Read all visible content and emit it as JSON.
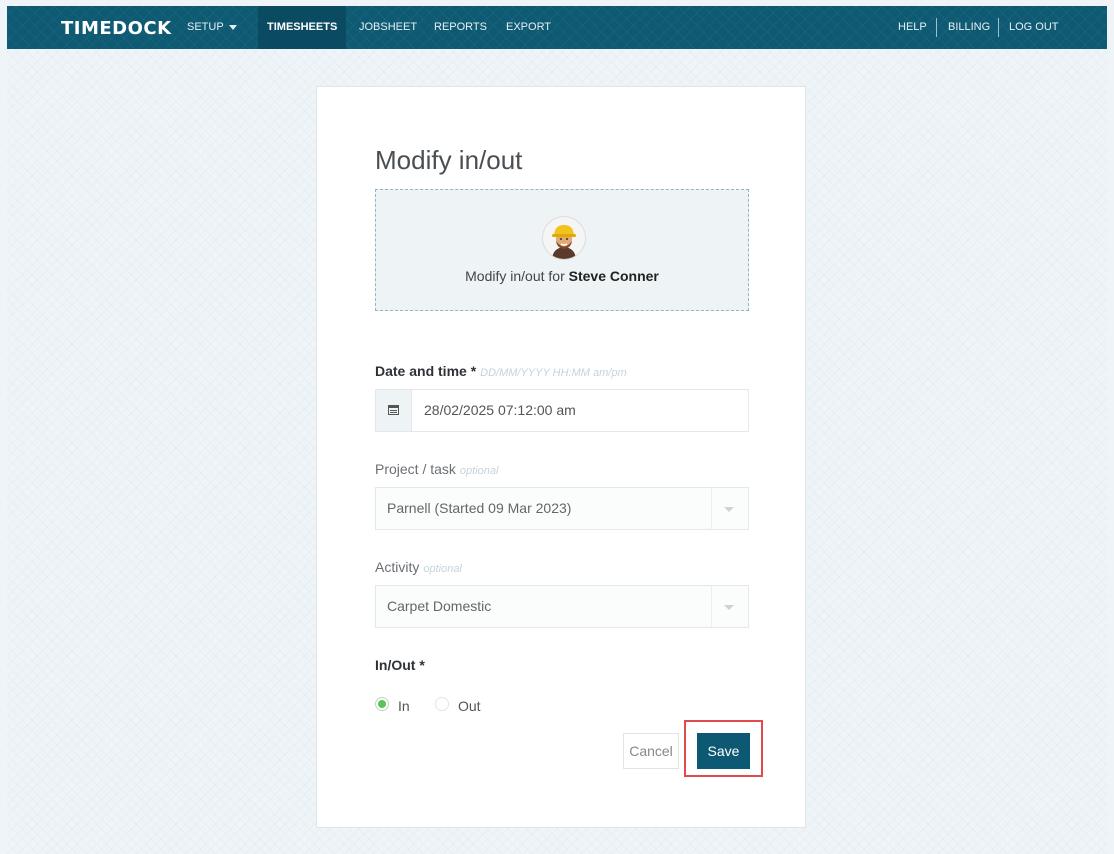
{
  "nav": {
    "logo": "TIMEDOCK",
    "items": [
      "SETUP",
      "TIMESHEETS",
      "JOBSHEET",
      "REPORTS",
      "EXPORT"
    ],
    "right": [
      "HELP",
      "BILLING",
      "LOG OUT"
    ]
  },
  "form": {
    "title": "Modify in/out",
    "employee_prefix": "Modify in/out for ",
    "employee_name": "Steve Conner",
    "date_label": "Date and time *",
    "date_hint": "DD/MM/YYYY HH:MM am/pm",
    "date_value": "28/02/2025 07:12:00 am",
    "project_label": "Project / task",
    "project_hint": "optional",
    "project_value": "Parnell (Started 09 Mar 2023)",
    "activity_label": "Activity",
    "activity_hint": "optional",
    "activity_value": "Carpet Domestic",
    "inout_label": "In/Out *",
    "radio_in": "In",
    "radio_out": "Out",
    "selected": "In",
    "cancel_label": "Cancel",
    "save_label": "Save"
  },
  "colors": {
    "nav": "#0e5a73",
    "save_button": "#0d5873",
    "highlight": "#e04a4a",
    "radio_on": "#5cc35c"
  }
}
